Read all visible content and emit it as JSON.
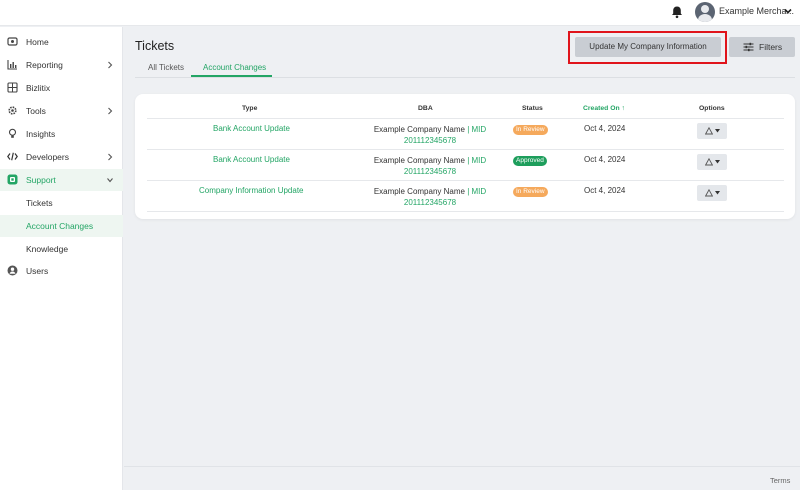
{
  "header": {
    "user_name": "Example Mercha...",
    "icons": [
      "bell-icon",
      "avatar",
      "chevron-down-icon"
    ]
  },
  "sidebar": {
    "items": [
      {
        "label": "Home",
        "icon": "home-icon"
      },
      {
        "label": "Reporting",
        "icon": "chart-icon"
      },
      {
        "label": "Bizlitix",
        "icon": "grid-icon"
      },
      {
        "label": "Tools",
        "icon": "gear-icon"
      },
      {
        "label": "Insights",
        "icon": "lightbulb-icon"
      },
      {
        "label": "Developers",
        "icon": "code-icon"
      },
      {
        "label": "Support",
        "icon": "support-icon"
      },
      {
        "label": "Tickets"
      },
      {
        "label": "Account Changes"
      },
      {
        "label": "Knowledge"
      },
      {
        "label": "Users",
        "icon": "user-icon"
      }
    ]
  },
  "page": {
    "title": "Tickets",
    "update_button_label": "Update My Company Information",
    "filters_button_label": "Filters",
    "tabs": [
      {
        "label": "All Tickets"
      },
      {
        "label": "Account Changes"
      }
    ]
  },
  "table": {
    "columns": [
      "Type",
      "DBA",
      "Status",
      "Created On ↑",
      "Options"
    ],
    "rows": [
      {
        "type": "Bank Account Update",
        "dba_name": "Example Company Name",
        "dba_sep": " | ",
        "mid_label": "MID",
        "mid_number": "201112345678",
        "status": "In Review",
        "created_on": "Oct 4, 2024"
      },
      {
        "type": "Bank Account Update",
        "dba_name": "Example Company Name",
        "dba_sep": " | ",
        "mid_label": "MID",
        "mid_number": "201112345678",
        "status": "Approved",
        "created_on": "Oct 4, 2024"
      },
      {
        "type": "Company Information Update",
        "dba_name": "Example Company Name",
        "dba_sep": " | ",
        "mid_label": "MID",
        "mid_number": "201112345678",
        "status": "In Review",
        "created_on": "Oct 4, 2024"
      }
    ]
  },
  "footer": {
    "terms_label": "Terms"
  },
  "colors": {
    "accent": "#23a565",
    "status_in_review": "#f5a95c",
    "status_approved": "#1e9e5c",
    "highlight_box": "#e0141b"
  }
}
